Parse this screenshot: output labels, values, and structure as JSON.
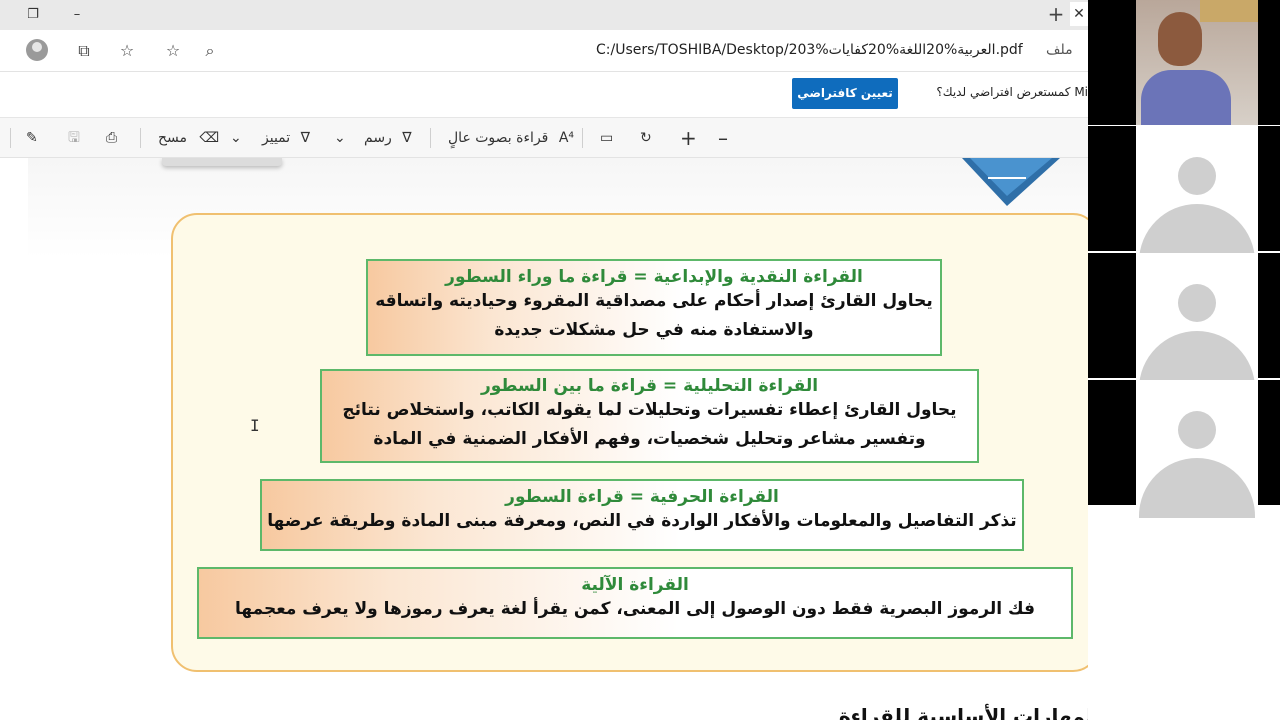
{
  "browser": {
    "url": "C:/Users/TOSHIBA/Desktop/203%العربية%20اللغة%20كفايات.pdf",
    "file_label": "ملف"
  },
  "default_prompt": {
    "text": "Mi كمستعرض افتراضي لديك؟",
    "button": "تعيين كافتراضي"
  },
  "pdf_toolbar": {
    "erase_label": "مسح",
    "highlight_label": "تمييز",
    "draw_label": "رسم",
    "read_aloud_label": "قراءة بصوت عالٍ"
  },
  "doc": {
    "boxes": [
      {
        "title": "القراءة النقدية والإبداعية = قراءة ما وراء السطور",
        "line1": "يحاول القارئ إصدار أحكام على مصداقية المقروء وحياديته واتساقه",
        "line2": "والاستفادة منه في حل مشكلات جديدة"
      },
      {
        "title": "القراءة التحليلية = قراءة ما بين السطور",
        "line1": "يحاول القارئ إعطاء تفسيرات وتحليلات لما يقوله الكاتب، واستخلاص نتائج",
        "line2": "وتفسير مشاعر وتحليل شخصيات، وفهم الأفكار الضمنية في المادة"
      },
      {
        "title": "القراءة الحرفية = قراءة السطور",
        "line1": "تذكر التفاصيل والمعلومات والأفكار الواردة في النص، ومعرفة مبنى المادة وطريقة عرضها"
      },
      {
        "title": "القراءة الآلية",
        "line1": "فك الرموز البصرية فقط دون الوصول إلى المعنى، كمن يقرأ لغة يعرف رموزها ولا يعرف معجمها"
      }
    ],
    "bottom_heading": "المهارات الأساسية للقراءة"
  },
  "icons": {
    "restore": "restore-icon",
    "minimize": "minimize-icon",
    "new_tab": "plus-icon",
    "close": "close-icon"
  },
  "colors": {
    "box_border": "#5db86a",
    "box_title": "#2f8a3a",
    "frame_border": "#f0c070",
    "button_blue": "#0f6cbd"
  }
}
